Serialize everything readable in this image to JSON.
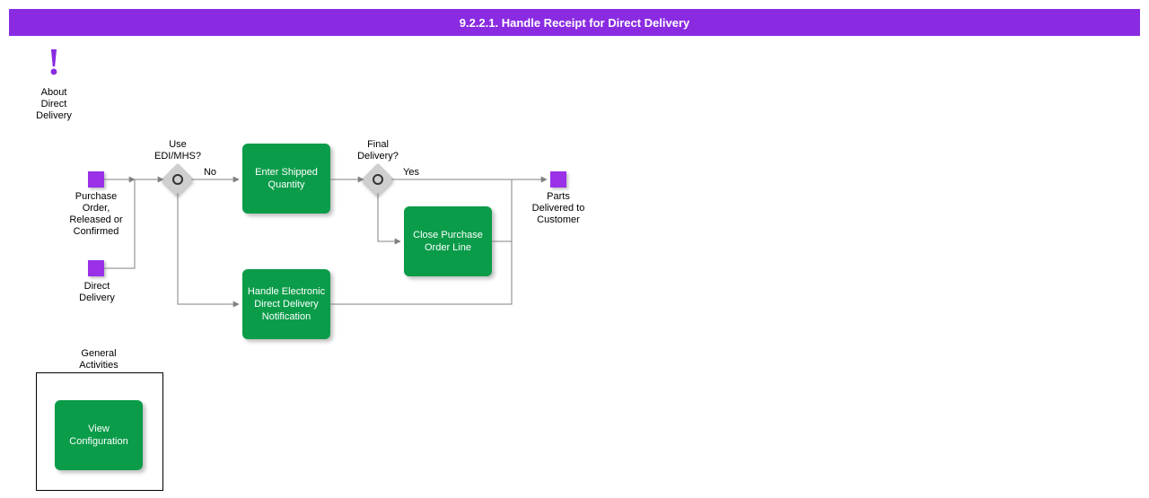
{
  "header": {
    "title": "9.2.2.1. Handle Receipt for Direct Delivery"
  },
  "info": {
    "label": "About\nDirect\nDelivery"
  },
  "events": {
    "purchase_order": {
      "label": "Purchase\nOrder,\nReleased or\nConfirmed"
    },
    "direct_delivery": {
      "label": "Direct\nDelivery"
    },
    "parts_delivered": {
      "label": "Parts\nDelivered to\nCustomer"
    }
  },
  "gateways": {
    "use_edi": {
      "label": "Use\nEDI/MHS?",
      "no": "No"
    },
    "final_delivery": {
      "label": "Final\nDelivery?",
      "yes": "Yes"
    }
  },
  "activities": {
    "enter_shipped": "Enter Shipped\nQuantity",
    "handle_edi": "Handle\nElectronic Direct\nDelivery\nNotification",
    "close_po": "Close Purchase\nOrder Line",
    "view_config": "View\nConfiguration"
  },
  "general": {
    "title": "General\nActivities"
  }
}
